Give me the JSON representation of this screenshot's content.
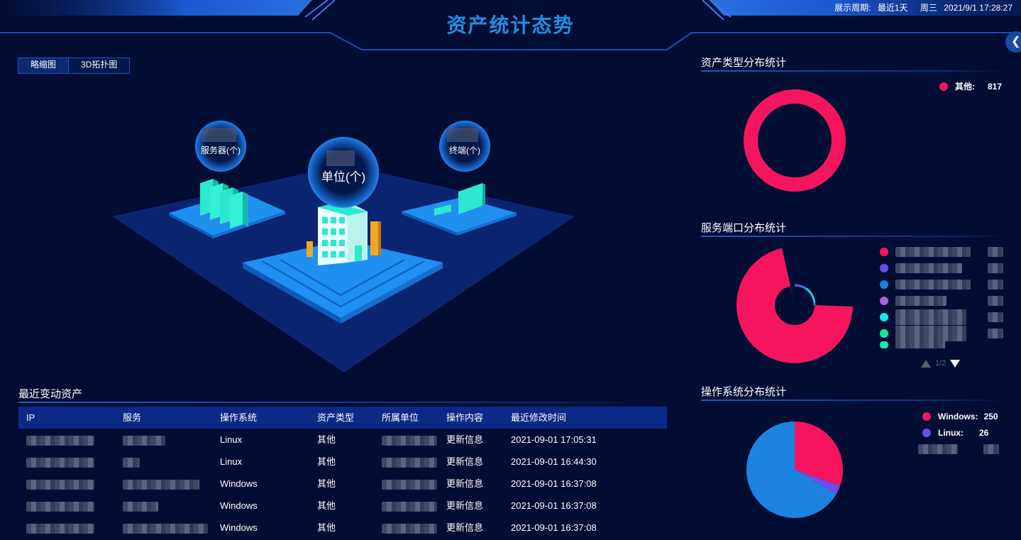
{
  "header": {
    "title": "资产统计态势",
    "period_label": "展示周期:",
    "period_value": "最近1天",
    "weekday": "周三",
    "datetime": "2021/9/1 17:28:27"
  },
  "view_tabs": [
    "略缩图",
    "3D拓扑图"
  ],
  "scene": {
    "server_label": "服务器(个)",
    "unit_label": "单位(个)",
    "terminal_label": "终端(个)"
  },
  "recent": {
    "title": "最近变动资产",
    "columns": [
      "IP",
      "服务",
      "操作系统",
      "资产类型",
      "所属单位",
      "操作内容",
      "最近修改时间"
    ],
    "rows": [
      {
        "os": "Linux",
        "type": "其他",
        "action": "更新信息",
        "time": "2021-09-01 17:05:31"
      },
      {
        "os": "Linux",
        "type": "其他",
        "action": "更新信息",
        "time": "2021-09-01 16:44:30"
      },
      {
        "os": "Windows",
        "type": "其他",
        "action": "更新信息",
        "time": "2021-09-01 16:37:08"
      },
      {
        "os": "Windows",
        "type": "其他",
        "action": "更新信息",
        "time": "2021-09-01 16:37:08"
      },
      {
        "os": "Windows",
        "type": "其他",
        "action": "更新信息",
        "time": "2021-09-01 16:37:08"
      }
    ]
  },
  "asset_type": {
    "title": "资产类型分布统计",
    "legend": [
      {
        "name": "其他:",
        "value": "817",
        "color": "#f5155f"
      }
    ]
  },
  "service_port": {
    "title": "服务端口分布统计",
    "legend_colors": [
      "#f5155f",
      "#6a4fe8",
      "#1c84e0",
      "#b05ce8",
      "#13e8f0",
      "#14e898",
      "#14e8b0"
    ],
    "pager": "1/2",
    "colors": {
      "main": "#f5155f",
      "inner": "#1c84e0"
    }
  },
  "os": {
    "title": "操作系统分布统计",
    "legend": [
      {
        "name": "Windows:",
        "value": "250",
        "color": "#f5155f"
      },
      {
        "name": "Linux:",
        "value": "26",
        "color": "#6a4fe8"
      }
    ],
    "chart_data": {
      "type": "pie",
      "categories": [
        "Windows",
        "Linux"
      ],
      "values": [
        250,
        26
      ]
    }
  }
}
